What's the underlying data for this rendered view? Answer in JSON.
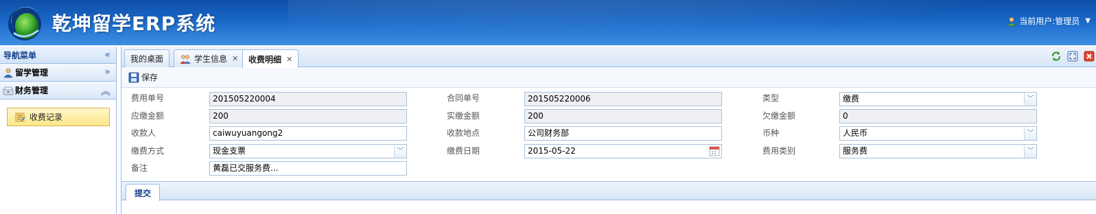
{
  "app": {
    "title": "乾坤留学ERP系统",
    "user_label": "当前用户:管理员"
  },
  "sidebar": {
    "title": "导航菜单",
    "sections": [
      {
        "label": "留学管理"
      },
      {
        "label": "财务管理"
      }
    ],
    "items": [
      {
        "label": "收费记录"
      }
    ]
  },
  "tabs": [
    {
      "label": "我的桌面"
    },
    {
      "label": "学生信息"
    },
    {
      "label": "收费明细"
    }
  ],
  "toolbar": {
    "save_label": "保存"
  },
  "form": {
    "fee_no": {
      "label": "费用单号",
      "value": "201505220004"
    },
    "contract_no": {
      "label": "合同单号",
      "value": "201505220006"
    },
    "type": {
      "label": "类型",
      "value": "缴费"
    },
    "due_amount": {
      "label": "应缴金额",
      "value": "200"
    },
    "paid_amount": {
      "label": "实缴金额",
      "value": "200"
    },
    "owed_amount": {
      "label": "欠缴金额",
      "value": "0"
    },
    "payee": {
      "label": "收款人",
      "value": "caiwuyuangong2"
    },
    "place": {
      "label": "收款地点",
      "value": "公司财务部"
    },
    "currency": {
      "label": "币种",
      "value": "人民币"
    },
    "method": {
      "label": "缴费方式",
      "value": "现金支票"
    },
    "date": {
      "label": "缴费日期",
      "value": "2015-05-22"
    },
    "category": {
      "label": "费用类别",
      "value": "服务费"
    },
    "note": {
      "label": "备注",
      "value": "黄磊已交服务费..."
    }
  },
  "subpanel": {
    "tab_label": "提交"
  },
  "colors": {
    "header": "#1a67c6",
    "border": "#99bbe8",
    "title_text": "#15428b"
  }
}
